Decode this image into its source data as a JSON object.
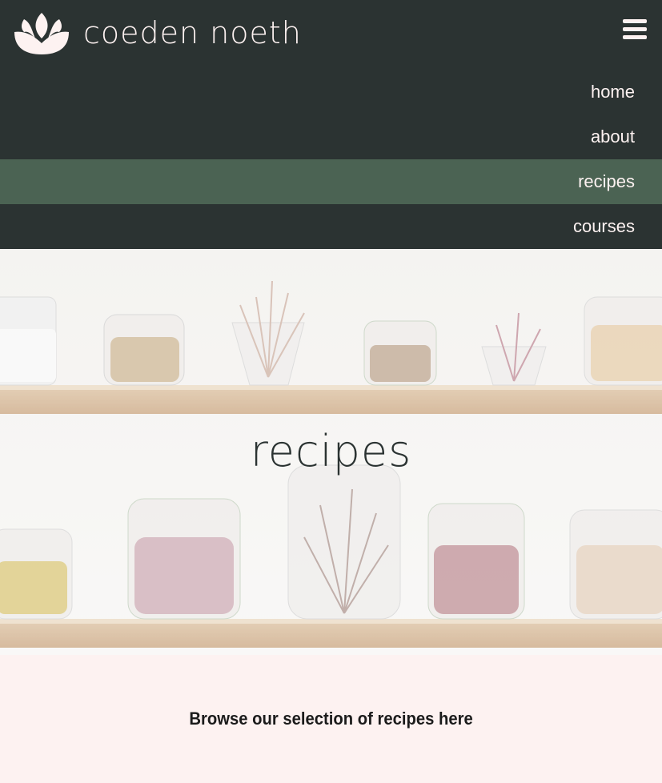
{
  "brand": {
    "name": "coeden noeth",
    "logo_icon": "lotus-icon",
    "text_color": "#fdf2f1"
  },
  "header": {
    "background": "#2b3332",
    "menu_icon": "hamburger-menu-icon"
  },
  "nav": {
    "items": [
      {
        "label": "home",
        "active": false
      },
      {
        "label": "about",
        "active": false
      },
      {
        "label": "recipes",
        "active": true
      },
      {
        "label": "courses",
        "active": false
      }
    ],
    "active_color": "#4b6353"
  },
  "hero": {
    "title": "recipes",
    "image": "glass jars of dried flowers and herbs on wooden shelves"
  },
  "intro": {
    "text": "Browse our selection of recipes here"
  }
}
